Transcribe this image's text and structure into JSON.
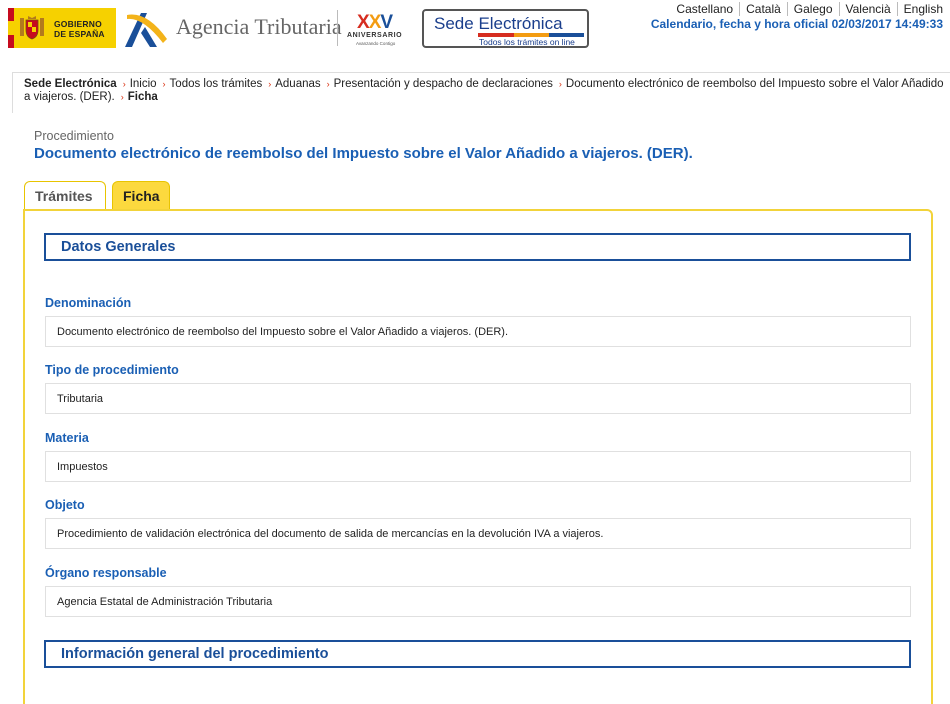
{
  "header": {
    "gov_logo_text_1": "GOBIERNO",
    "gov_logo_text_2": "DE ESPAÑA",
    "agency_name": "Agencia Tributaria",
    "anniversary_number": [
      "X",
      "X",
      "V"
    ],
    "anniversary_label": "ANIVERSARIO",
    "anniversary_sub": "Avanzando Contigo",
    "sede_title_1": "Sede ",
    "sede_title_2": "Electrónica",
    "sede_subtitle": "Todos los trámites on line",
    "sede_bar_colors": [
      "#d62d20",
      "#f39c12",
      "#1a4f99"
    ],
    "languages": [
      "Castellano",
      "Català",
      "Galego",
      "Valencià",
      "English"
    ],
    "official_clock": "Calendario, fecha y hora oficial 02/03/2017 14:49:33"
  },
  "breadcrumb": {
    "items": [
      "Sede Electrónica",
      "Inicio",
      "Todos los trámites",
      "Aduanas",
      "Presentación y despacho de declaraciones",
      "Documento electrónico de reembolso del Impuesto sobre el Valor Añadido a viajeros. (DER).",
      "Ficha"
    ],
    "separator": "›"
  },
  "page": {
    "kicker": "Procedimiento",
    "title": "Documento electrónico de reembolso del Impuesto sobre el Valor Añadido a viajeros. (DER)."
  },
  "tabs": {
    "tramites": "Trámites",
    "ficha": "Ficha",
    "active": "ficha"
  },
  "sections": {
    "general": "Datos Generales",
    "info": "Información general del procedimiento"
  },
  "fields": {
    "denominacion": {
      "label": "Denominación",
      "value": "Documento electrónico de reembolso del Impuesto sobre el Valor Añadido a viajeros. (DER)."
    },
    "tipo": {
      "label": "Tipo de procedimiento",
      "value": "Tributaria"
    },
    "materia": {
      "label": "Materia",
      "value": "Impuestos"
    },
    "objeto": {
      "label": "Objeto",
      "value": "Procedimiento de validación electrónica del documento de salida de mercancías en la devolución IVA a viajeros."
    },
    "organo": {
      "label": "Órgano responsable",
      "value": "Agencia Estatal de Administración Tributaria"
    }
  },
  "colors": {
    "link_blue": "#1a5fb4",
    "section_blue": "#1a4f99",
    "tab_active": "#fcd93e",
    "panel_border": "#f2d33a",
    "crumb_arrow": "#d9300f"
  }
}
